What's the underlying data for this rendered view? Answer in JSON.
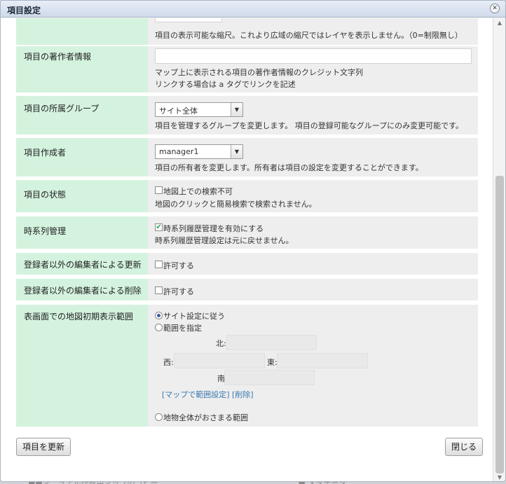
{
  "dialog": {
    "title": "項目設定",
    "close_icon": "close-icon"
  },
  "rows": {
    "scale": {
      "desc": "項目の表示可能な縮尺。これより広域の縮尺ではレイヤを表示しません。（0=制限無し）"
    },
    "credit": {
      "label": "項目の著作者情報",
      "value": "",
      "desc1": "マップ上に表示される項目の著作者情報のクレジット文字列",
      "desc2": "リンクする場合は a タグでリンクを記述"
    },
    "group": {
      "label": "項目の所属グループ",
      "selected": "サイト全体",
      "desc": "項目を管理するグループを変更します。 項目の登録可能なグループにのみ変更可能です。"
    },
    "author": {
      "label": "項目作成者",
      "selected": "manager1",
      "desc": "項目の所有者を変更します。所有者は項目の設定を変更することができます。"
    },
    "status": {
      "label": "項目の状態",
      "checkbox_label": "地図上での検索不可",
      "checked": false,
      "desc": "地図のクリックと簡易検索で検索されません。"
    },
    "timeseries": {
      "label": "時系列管理",
      "checkbox_label": "時系列履歴管理を有効にする",
      "checked": true,
      "desc": "時系列履歴管理設定は元に戻せません。"
    },
    "update": {
      "label": "登録者以外の編集者による更新",
      "checkbox_label": "許可する",
      "checked": false
    },
    "delete": {
      "label": "登録者以外の編集者による削除",
      "checkbox_label": "許可する",
      "checked": false
    },
    "extent": {
      "label": "表画面での地図初期表示範囲",
      "radio_site": "サイト設定に従う",
      "radio_range": "範囲を指定",
      "radio_all": "地物全体がおさまる範囲",
      "selected": "サイト設定に従う",
      "north": "北:",
      "west": "西:",
      "east": "東:",
      "south": "南",
      "map_link": "[マップで範囲設定]",
      "delete_link": "[削除]"
    }
  },
  "buttons": {
    "update": "項目を更新",
    "close": "閉じる"
  },
  "background": {
    "left_text": "■■マニュアル作成用マップのコピー",
    "right_text": "■ メタデータ"
  }
}
